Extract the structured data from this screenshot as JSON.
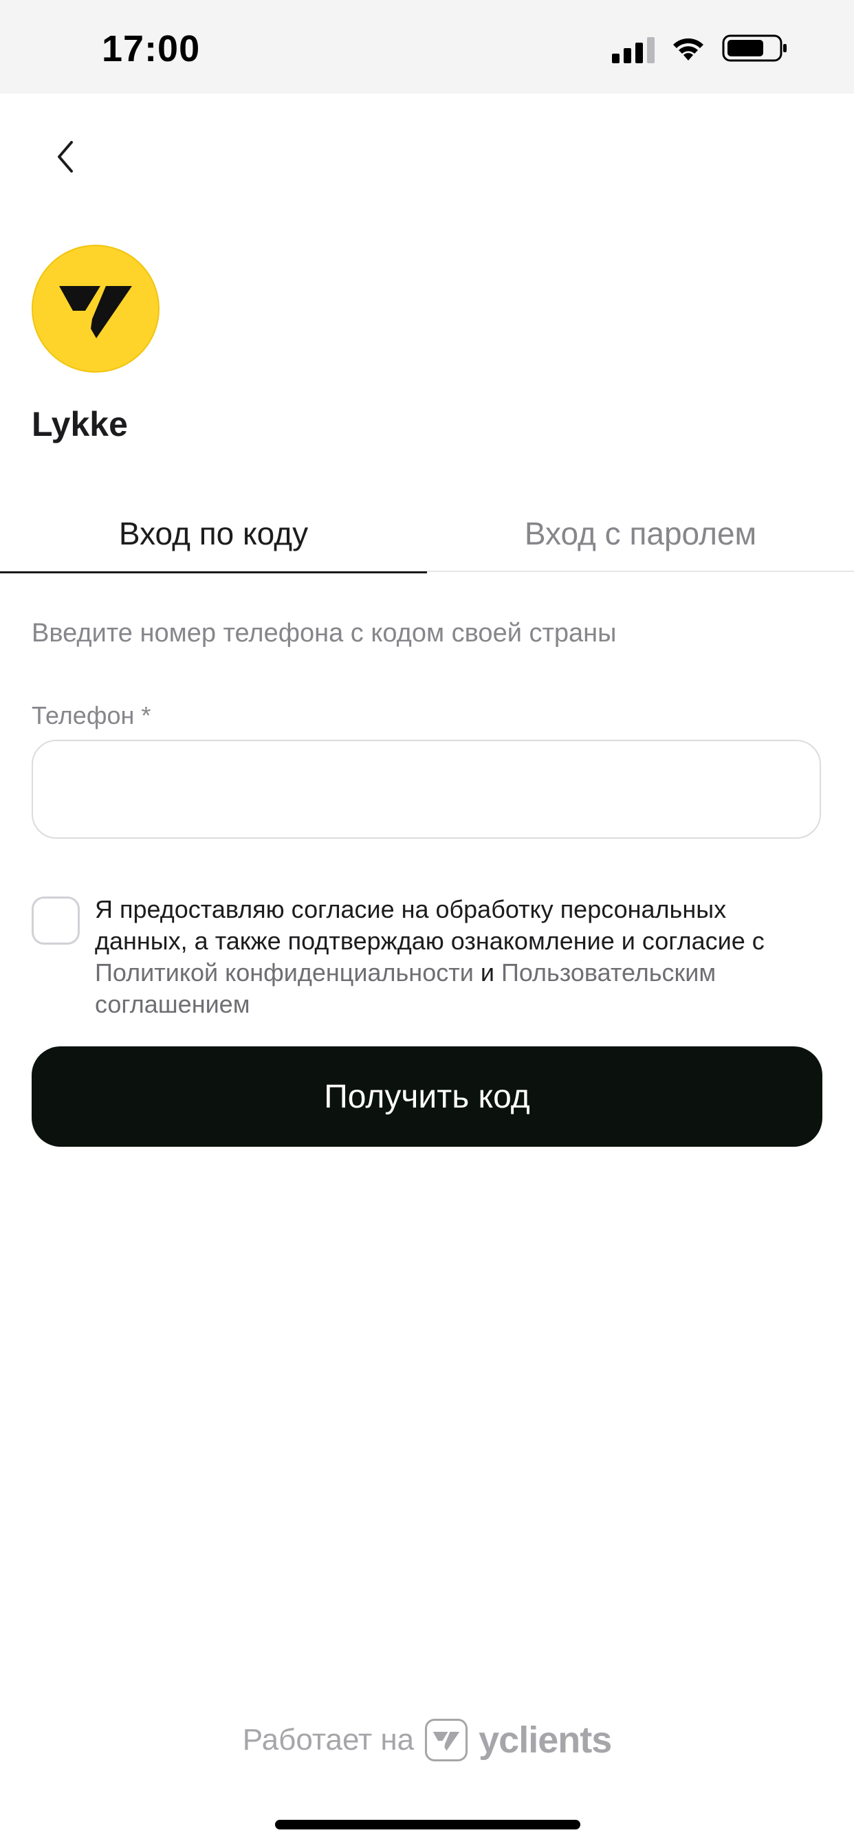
{
  "status_bar": {
    "time": "17:00",
    "icons": [
      "cellular-signal-icon",
      "wifi-icon",
      "battery-icon"
    ]
  },
  "nav": {
    "back_icon": "chevron-left-icon"
  },
  "company": {
    "name": "Lykke",
    "logo_color": "#ffd42a"
  },
  "tabs": [
    {
      "label": "Вход по коду",
      "active": true
    },
    {
      "label": "Вход с паролем",
      "active": false
    }
  ],
  "form": {
    "hint": "Введите номер телефона с кодом своей страны",
    "phone_label": "Телефон *",
    "phone_value": "",
    "phone_placeholder": "",
    "consent": {
      "checked": false,
      "text_before": "Я предоставляю согласие на обработку персональных данных, а также подтверждаю ознакомление и согласие с ",
      "privacy_link": "Политикой конфиденциальности",
      "and": " и ",
      "terms_link": "Пользовательским соглашением"
    },
    "submit_label": "Получить код"
  },
  "footer": {
    "powered_by": "Работает на",
    "brand": "yclients"
  },
  "colors": {
    "button_bg": "#0b120d",
    "muted_text": "#86868b",
    "accent_yellow": "#ffd42a"
  }
}
